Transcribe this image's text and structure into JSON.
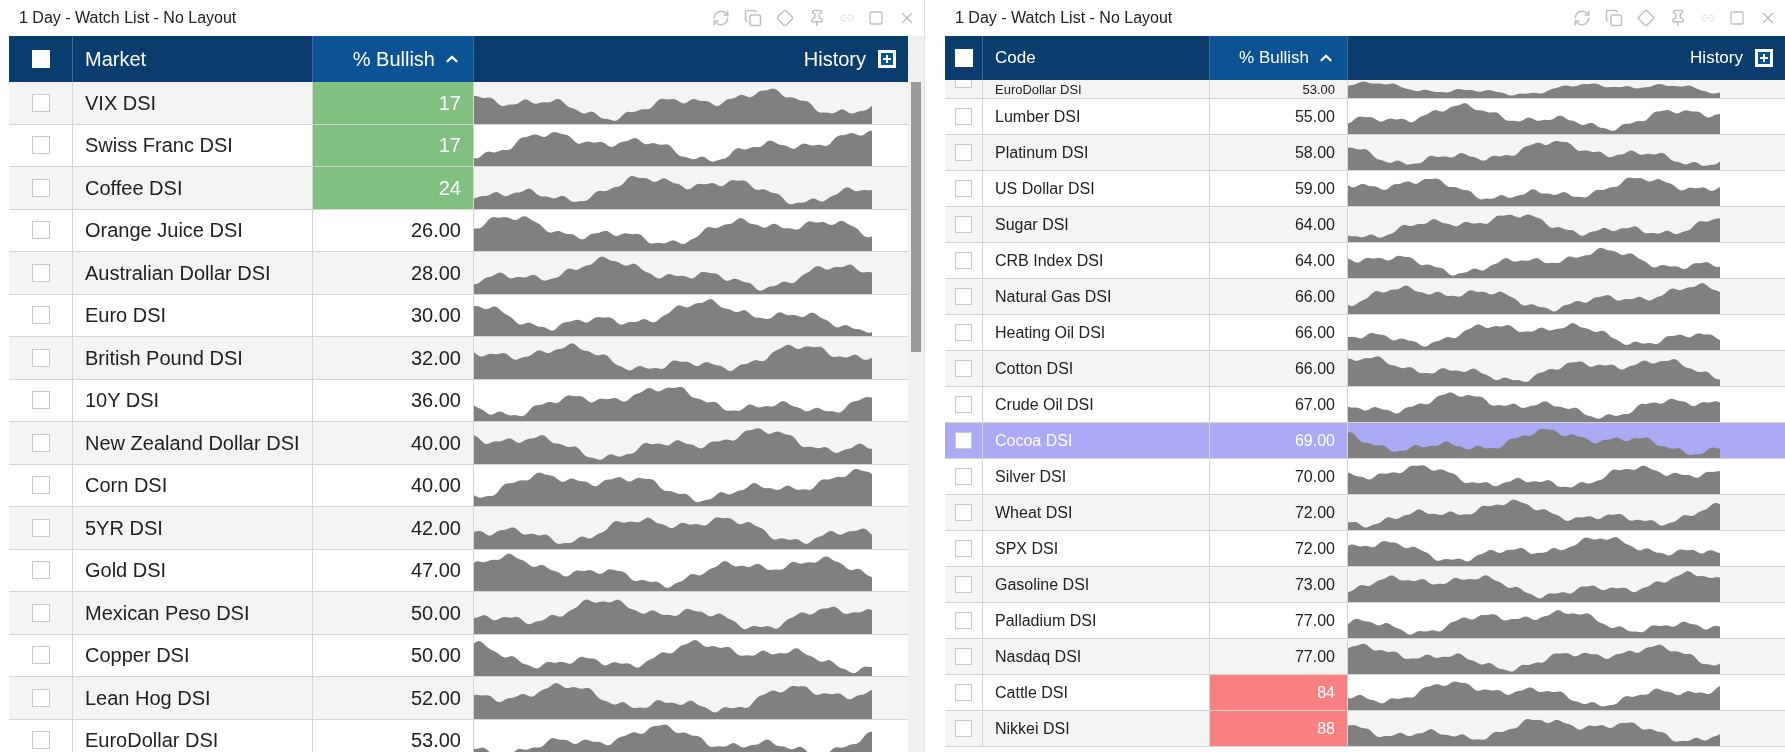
{
  "panels": [
    {
      "title": "1 Day - Watch List - No Layout",
      "select_all_checked": false,
      "columns": {
        "name": "Market",
        "value": "% Bullish",
        "history": "History"
      },
      "rows": [
        {
          "name": "VIX DSI",
          "value": "17",
          "color": "#80c080",
          "checked": false,
          "selected": false
        },
        {
          "name": "Swiss Franc DSI",
          "value": "17",
          "color": "#80c080",
          "checked": false,
          "selected": false
        },
        {
          "name": "Coffee DSI",
          "value": "24",
          "color": "#80c080",
          "checked": false,
          "selected": false
        },
        {
          "name": "Orange Juice DSI",
          "value": "26.00",
          "checked": false,
          "selected": false
        },
        {
          "name": "Australian Dollar DSI",
          "value": "28.00",
          "checked": false,
          "selected": false
        },
        {
          "name": "Euro DSI",
          "value": "30.00",
          "checked": false,
          "selected": false
        },
        {
          "name": "British Pound DSI",
          "value": "32.00",
          "checked": false,
          "selected": false
        },
        {
          "name": "10Y DSI",
          "value": "36.00",
          "checked": false,
          "selected": false
        },
        {
          "name": "New Zealand Dollar DSI",
          "value": "40.00",
          "checked": false,
          "selected": false
        },
        {
          "name": "Corn DSI",
          "value": "40.00",
          "checked": false,
          "selected": false
        },
        {
          "name": "5YR DSI",
          "value": "42.00",
          "checked": false,
          "selected": false
        },
        {
          "name": "Gold DSI",
          "value": "47.00",
          "checked": false,
          "selected": false
        },
        {
          "name": "Mexican Peso DSI",
          "value": "50.00",
          "checked": false,
          "selected": false
        },
        {
          "name": "Copper DSI",
          "value": "50.00",
          "checked": false,
          "selected": false
        },
        {
          "name": "Lean Hog DSI",
          "value": "52.00",
          "checked": false,
          "selected": false
        },
        {
          "name": "EuroDollar DSI",
          "value": "53.00",
          "checked": false,
          "selected": false
        }
      ]
    },
    {
      "title": "1 Day - Watch List - No Layout",
      "select_all_checked": false,
      "columns": {
        "name": "Code",
        "value": "% Bullish",
        "history": "History"
      },
      "rows": [
        {
          "name": "EuroDollar DSI",
          "value": "53.00",
          "checked": false,
          "selected": false
        },
        {
          "name": "Lumber DSI",
          "value": "55.00",
          "checked": false,
          "selected": false
        },
        {
          "name": "Platinum DSI",
          "value": "58.00",
          "checked": false,
          "selected": false
        },
        {
          "name": "US Dollar DSI",
          "value": "59.00",
          "checked": false,
          "selected": false
        },
        {
          "name": "Sugar DSI",
          "value": "64.00",
          "checked": false,
          "selected": false
        },
        {
          "name": "CRB Index DSI",
          "value": "64.00",
          "checked": false,
          "selected": false
        },
        {
          "name": "Natural Gas DSI",
          "value": "66.00",
          "checked": false,
          "selected": false
        },
        {
          "name": "Heating Oil DSI",
          "value": "66.00",
          "checked": false,
          "selected": false
        },
        {
          "name": "Cotton DSI",
          "value": "66.00",
          "checked": false,
          "selected": false
        },
        {
          "name": "Crude Oil DSI",
          "value": "67.00",
          "checked": false,
          "selected": false
        },
        {
          "name": "Cocoa DSI",
          "value": "69.00",
          "checked": false,
          "selected": true
        },
        {
          "name": "Silver DSI",
          "value": "70.00",
          "checked": false,
          "selected": false
        },
        {
          "name": "Wheat DSI",
          "value": "72.00",
          "checked": false,
          "selected": false
        },
        {
          "name": "SPX DSI",
          "value": "72.00",
          "checked": false,
          "selected": false
        },
        {
          "name": "Gasoline DSI",
          "value": "73.00",
          "checked": false,
          "selected": false
        },
        {
          "name": "Palladium DSI",
          "value": "77.00",
          "checked": false,
          "selected": false
        },
        {
          "name": "Nasdaq DSI",
          "value": "77.00",
          "checked": false,
          "selected": false
        },
        {
          "name": "Cattle DSI",
          "value": "84",
          "color": "#f88080",
          "checked": false,
          "selected": false
        },
        {
          "name": "Nikkei DSI",
          "value": "88",
          "color": "#f88080",
          "checked": false,
          "selected": false
        }
      ]
    }
  ]
}
